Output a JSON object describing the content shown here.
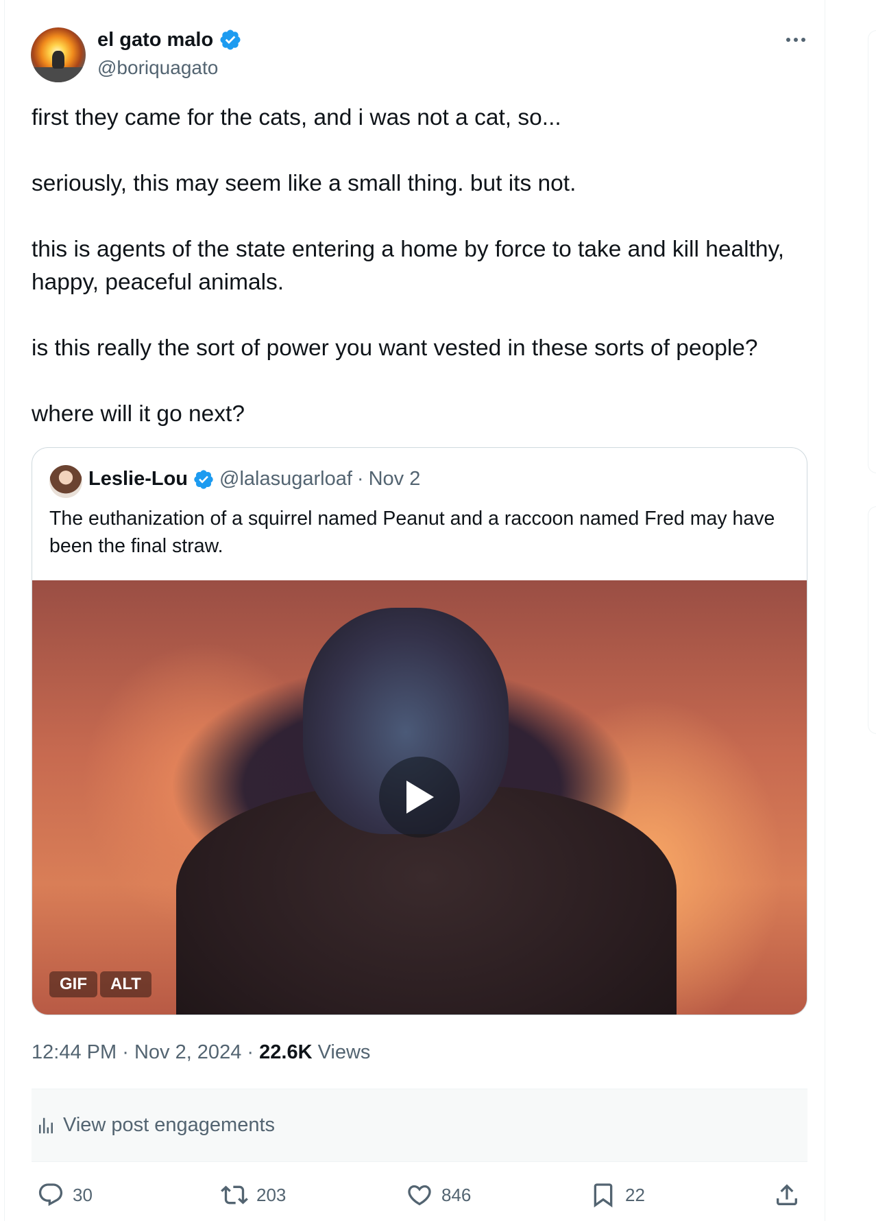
{
  "author": {
    "display_name": "el gato malo",
    "handle": "@boriquagato"
  },
  "tweet": {
    "paragraphs": [
      "first they came for the cats, and i was not a cat, so...",
      "seriously, this may seem like a small thing.  but its not.",
      "this is agents of the state entering a home by force to take and kill healthy, happy, peaceful animals.",
      "is this really the sort of power you want vested in these sorts of people?",
      "where will it go next?"
    ]
  },
  "quote": {
    "display_name": "Leslie-Lou",
    "handle": "@lalasugarloaf",
    "separator": "·",
    "date": "Nov 2",
    "text": "The euthanization of a squirrel named Peanut and a raccoon named Fred may have been the final straw.",
    "badges": [
      "GIF",
      "ALT"
    ]
  },
  "meta": {
    "time": "12:44 PM",
    "separator": "·",
    "date": "Nov 2, 2024",
    "views_count": "22.6K",
    "views_label": "Views"
  },
  "engagements_label": "View post engagements",
  "actions": {
    "replies": "30",
    "reposts": "203",
    "likes": "846",
    "bookmarks": "22"
  },
  "colors": {
    "verified": "#1d9bf0",
    "secondary_text": "#536471",
    "primary_text": "#0f1419"
  }
}
